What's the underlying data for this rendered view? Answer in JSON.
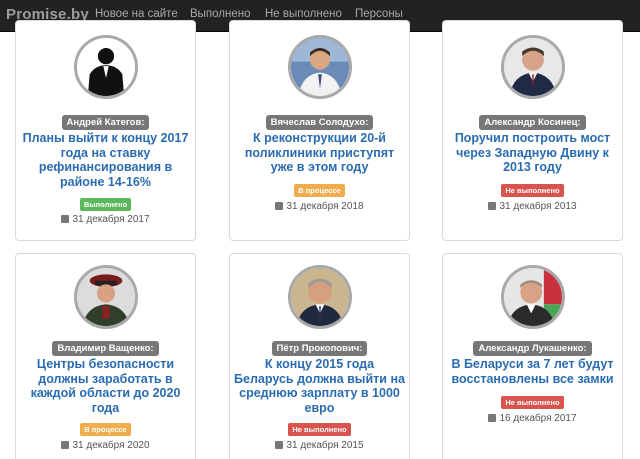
{
  "header": {
    "brand": "Promise.by",
    "nav": [
      "Новое на сайте",
      "Выполнено",
      "Не выполнено",
      "Персоны"
    ]
  },
  "colors": {
    "done": "#5cb85c",
    "in_progress": "#f0ad4e",
    "not_done": "#d9534f",
    "title_link": "#2a6cb1"
  },
  "cards": [
    {
      "person": "Андрей Категов:",
      "title": "Планы выйти к концу 2017 года на ставку рефинансирования в районе 14-16%",
      "status": "Выполнено",
      "status_kind": "done",
      "date": "31 декабря 2017",
      "avatar": "anonymous-silhouette"
    },
    {
      "person": "Вячеслав Солодухо:",
      "title": "К реконструкции 20-й поликлиники приступят уже в этом году",
      "status": "В процессе",
      "status_kind": "in_progress",
      "date": "31 декабря 2018",
      "avatar": "man-portrait"
    },
    {
      "person": "Александр Косинец:",
      "title": "Поручил построить мост через Западную Двину к 2013 году",
      "status": "Не выполнено",
      "status_kind": "not_done",
      "date": "31 декабря 2013",
      "avatar": "man-portrait"
    },
    {
      "person": "Владимир Ващенко:",
      "title": "Центры безопасности должны заработать в каждой области до 2020 года",
      "status": "В процессе",
      "status_kind": "in_progress",
      "date": "31 декабря 2020",
      "avatar": "man-in-uniform"
    },
    {
      "person": "Пётр Прокопович:",
      "title": "К концу 2015 года Беларусь должна выйти на среднюю зарплату в 1000 евро",
      "status": "Не выполнено",
      "status_kind": "not_done",
      "date": "31 декабря 2015",
      "avatar": "man-portrait"
    },
    {
      "person": "Александр Лукашенко:",
      "title": "В Беларуси за 7 лет будут восстановлены все замки",
      "status": "Не выполнено",
      "status_kind": "not_done",
      "date": "16 декабря 2017",
      "avatar": "man-portrait-flag"
    }
  ]
}
